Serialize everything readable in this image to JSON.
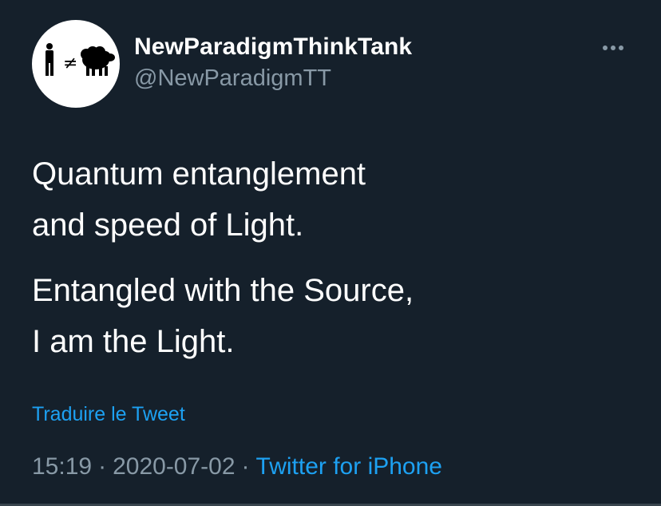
{
  "tweet": {
    "display_name": "NewParadigmThinkTank",
    "handle": "@NewParadigmTT",
    "avatar_icon": "person-not-equal-sheep-icon",
    "avatar_symbol": "≠",
    "more_icon": "more-options-icon",
    "paragraphs": [
      {
        "lines": [
          "Quantum entanglement",
          "and speed of Light."
        ]
      },
      {
        "lines": [
          "Entangled with the Source,",
          "I am the Light."
        ]
      }
    ],
    "translate_label": "Traduire le Tweet",
    "time": "15:19",
    "separator": "·",
    "date": "2020-07-02",
    "source": "Twitter for iPhone"
  },
  "colors": {
    "background": "#15202b",
    "primary_text": "#ffffff",
    "secondary_text": "#8899a6",
    "link": "#1da1f2",
    "divider": "#38444d"
  }
}
